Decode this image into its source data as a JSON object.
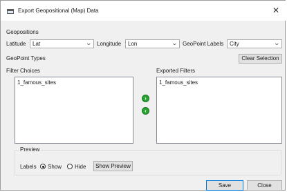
{
  "window": {
    "title": "Export Geopositional (Map) Data",
    "close_icon": "close-icon"
  },
  "geopositions": {
    "section_label": "Geopositions",
    "latitude_label": "Latitude",
    "latitude_value": "Lat",
    "longitude_label": "Longitude",
    "longitude_value": "Lon",
    "geopoint_labels_label": "GeoPoint Labels",
    "geopoint_labels_value": "City"
  },
  "geopoint_types": {
    "section_label": "GeoPoint Types",
    "clear_selection_label": "Clear Selection",
    "filter_choices_label": "Filter Choices",
    "filter_choices_items": [
      "1_famous_sites"
    ],
    "exported_filters_label": "Exported Filters",
    "exported_filters_items": [
      "1_famous_sites"
    ],
    "add_icon": "arrow-right-icon",
    "remove_icon": "arrow-left-icon"
  },
  "preview": {
    "group_label": "Preview",
    "labels_label": "Labels",
    "show_label": "Show",
    "show_checked": true,
    "hide_label": "Hide",
    "hide_checked": false,
    "show_preview_label": "Show Preview"
  },
  "footer": {
    "save_label": "Save",
    "close_label": "Close"
  },
  "colors": {
    "accent_green": "#27a12f",
    "dialog_bg": "#f0f0f0"
  }
}
